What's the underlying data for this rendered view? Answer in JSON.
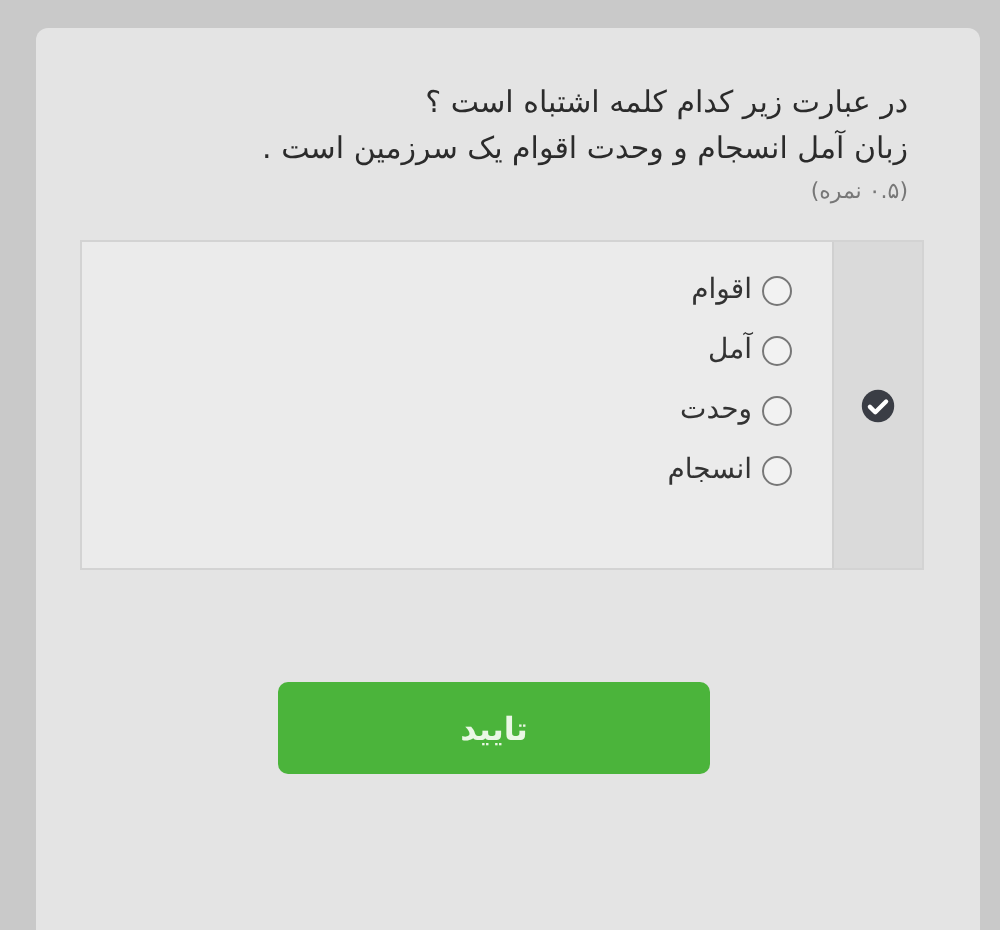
{
  "question": {
    "lines": [
      "در عبارت زیر کدام کلمه اشتباه است ؟",
      "زبان آمل انسجام و وحدت اقوام یک سرزمین است ."
    ],
    "score": "(۰.۵ نمره)"
  },
  "options": [
    {
      "label": "اقوام",
      "selected": false
    },
    {
      "label": "آمل",
      "selected": false
    },
    {
      "label": "وحدت",
      "selected": false
    },
    {
      "label": "انسجام",
      "selected": false
    }
  ],
  "submit": "تایید"
}
